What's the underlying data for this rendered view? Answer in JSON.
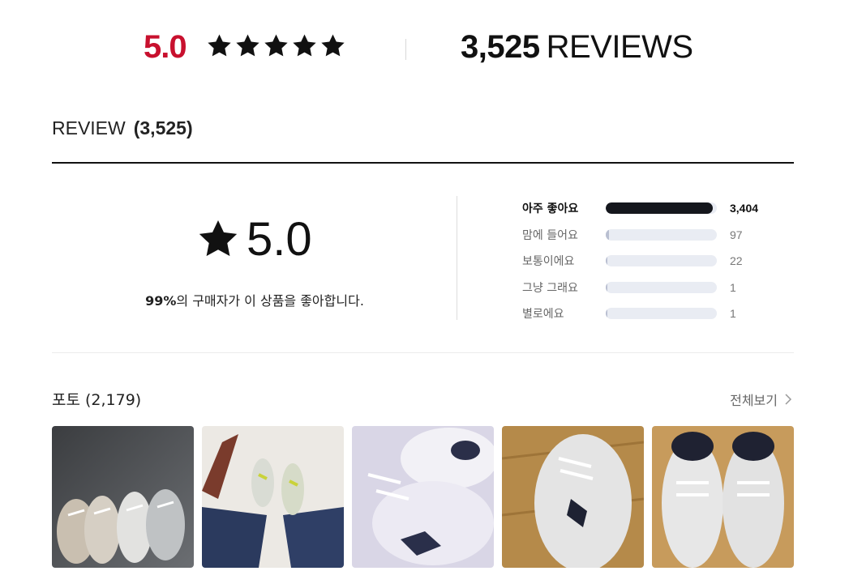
{
  "summary": {
    "score": "5.0",
    "stars": 5,
    "review_count": "3,525",
    "reviews_word": "REVIEWS",
    "accent_color": "#c8102e"
  },
  "review_header": {
    "title": "REVIEW",
    "count": "(3,525)"
  },
  "score_block": {
    "icon": "star-icon",
    "score": "5.0",
    "percent": "99%",
    "caption_rest": "의 구매자가 이 상품을 좋아합니다."
  },
  "distribution": [
    {
      "label": "아주 좋아요",
      "count": "3,404",
      "fraction": 0.966
    },
    {
      "label": "맘에 들어요",
      "count": "97",
      "fraction": 0.028
    },
    {
      "label": "보통이에요",
      "count": "22",
      "fraction": 0.006
    },
    {
      "label": "그냥 그래요",
      "count": "1",
      "fraction": 0.0003
    },
    {
      "label": "별로에요",
      "count": "1",
      "fraction": 0.0003
    }
  ],
  "photos": {
    "title": "포토 (2,179)",
    "view_all": "전체보기",
    "view_all_icon": "chevron-right-icon",
    "count_shown": 5
  }
}
